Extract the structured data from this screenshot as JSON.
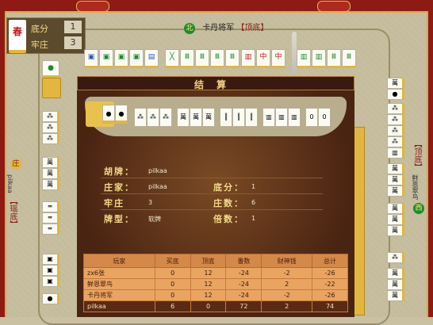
{
  "score_panel": {
    "base_label": "底分",
    "base_value": "1",
    "dealer_label": "牢庄",
    "dealer_value": "3",
    "tile_glyph": "春"
  },
  "top_player": {
    "badge": "北",
    "name": "卡丹将军",
    "position": "【顶底】"
  },
  "left_player": {
    "badge": "庄",
    "name": "pilkaa",
    "position": "【瑶底】"
  },
  "right_player": {
    "name": "鲜恩翠鸟",
    "position": "【顶底】",
    "badge": "西"
  },
  "dialog": {
    "title": "结算",
    "hu_label": "胡牌：",
    "hu_value": "pilkaa",
    "dealer_label": "庄家：",
    "dealer_value": "pilkaa",
    "base_label": "底分：",
    "base_value": "1",
    "laozhuang_label": "牢庄",
    "laozhuang_value": "3",
    "fan_label": "庄数：",
    "fan_value": "6",
    "type_label": "牌型：",
    "type_value": "软牌",
    "multi_label": "倍数：",
    "multi_value": "1"
  },
  "table": {
    "headers": [
      "玩家",
      "买底",
      "顶底",
      "番数",
      "财神钱",
      "总计"
    ],
    "rows": [
      [
        "zx6张",
        "0",
        "12",
        "-24",
        "-2",
        "-26"
      ],
      [
        "鲜恩翠鸟",
        "0",
        "12",
        "-24",
        "2",
        "-22"
      ],
      [
        "卡丹将军",
        "0",
        "12",
        "-24",
        "-2",
        "-26"
      ],
      [
        "pilkaa",
        "6",
        "0",
        "72",
        "2",
        "74"
      ]
    ]
  },
  "colors": {
    "frame": "#8e1b13",
    "felt": "#c4bc9c",
    "dialog": "#4a2412",
    "tile_back": "#e3b640"
  }
}
